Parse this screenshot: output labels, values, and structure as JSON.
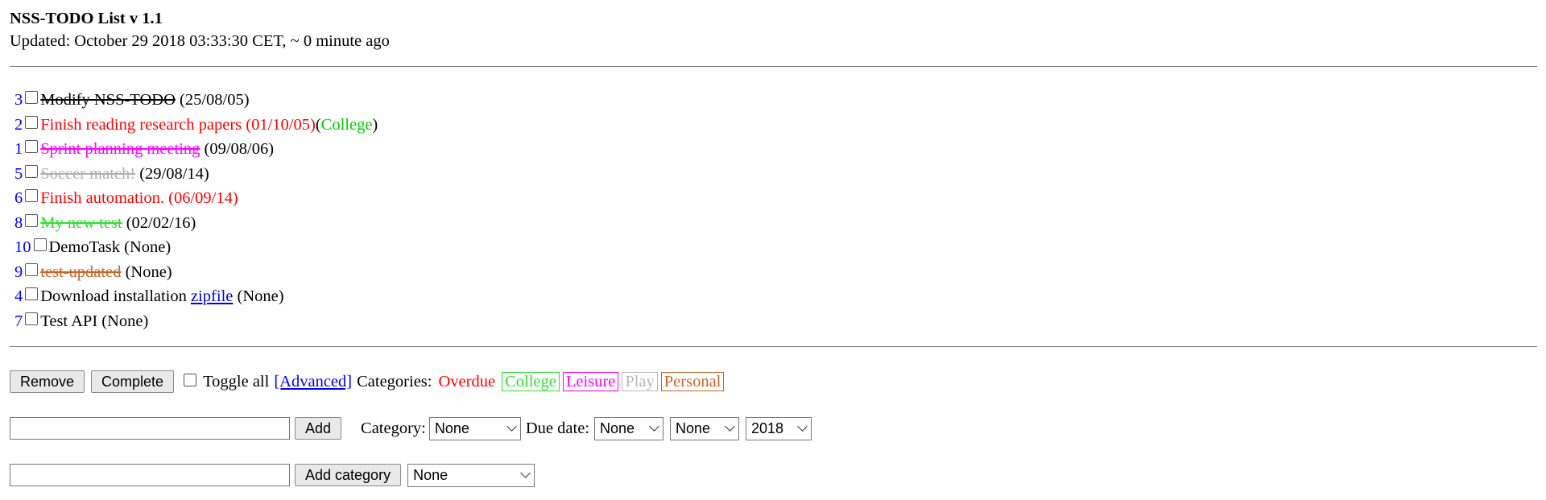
{
  "header": {
    "title": "NSS-TODO List v 1.1",
    "updated": "Updated: October 29 2018 03:33:30 CET, ~ 0 minute ago"
  },
  "tasks": [
    {
      "num": "3",
      "text": "Modify NSS-TODO",
      "date": "(25/08/05)",
      "color": "#000000",
      "strike": true
    },
    {
      "num": "2",
      "text": "Finish reading research papers",
      "date": "(01/10/05)",
      "date_color": "#ff0000",
      "color": "#ff0000",
      "strike": false,
      "category": "College",
      "category_color": "#00cc00"
    },
    {
      "num": "1",
      "text": "Sprint planning meeting",
      "date": "(09/08/06)",
      "color": "#ff00ff",
      "strike": true
    },
    {
      "num": "5",
      "text": "Soccer match!",
      "date": "(29/08/14)",
      "color": "#b0b0b0",
      "strike": true
    },
    {
      "num": "6",
      "text": "Finish automation.",
      "date": "(06/09/14)",
      "date_color": "#ff0000",
      "color": "#ff0000",
      "strike": false
    },
    {
      "num": "8",
      "text": "My new test",
      "date": "(02/02/16)",
      "color": "#33dd33",
      "strike": true
    },
    {
      "num": "10",
      "text": "DemoTask",
      "date": "(None)",
      "color": "#000000",
      "strike": false
    },
    {
      "num": "9",
      "text": "test-updated",
      "date": "(None)",
      "color": "#c86428",
      "strike": true
    },
    {
      "num": "4",
      "text": "Download installation",
      "link": "zipfile",
      "date": "(None)",
      "color": "#000000",
      "strike": false
    },
    {
      "num": "7",
      "text": "Test API",
      "date": "(None)",
      "color": "#000000",
      "strike": false
    }
  ],
  "controls": {
    "remove_label": "Remove",
    "complete_label": "Complete",
    "toggle_all_label": "Toggle all",
    "advanced_label": "[Advanced]",
    "categories_label": "Categories:",
    "overdue_label": "Overdue",
    "overdue_color": "#ff0000",
    "categories": [
      {
        "name": "College",
        "color": "#33dd33"
      },
      {
        "name": "Leisure",
        "color": "#ff00ff"
      },
      {
        "name": "Play",
        "color": "#b8b8b8"
      },
      {
        "name": "Personal",
        "color": "#c86428"
      }
    ]
  },
  "add_form": {
    "add_label": "Add",
    "category_label": "Category:",
    "category_value": "None",
    "due_label": "Due date:",
    "day_value": "None",
    "month_value": "None",
    "year_value": "2018"
  },
  "category_form": {
    "add_category_label": "Add category",
    "select_value": "None"
  }
}
